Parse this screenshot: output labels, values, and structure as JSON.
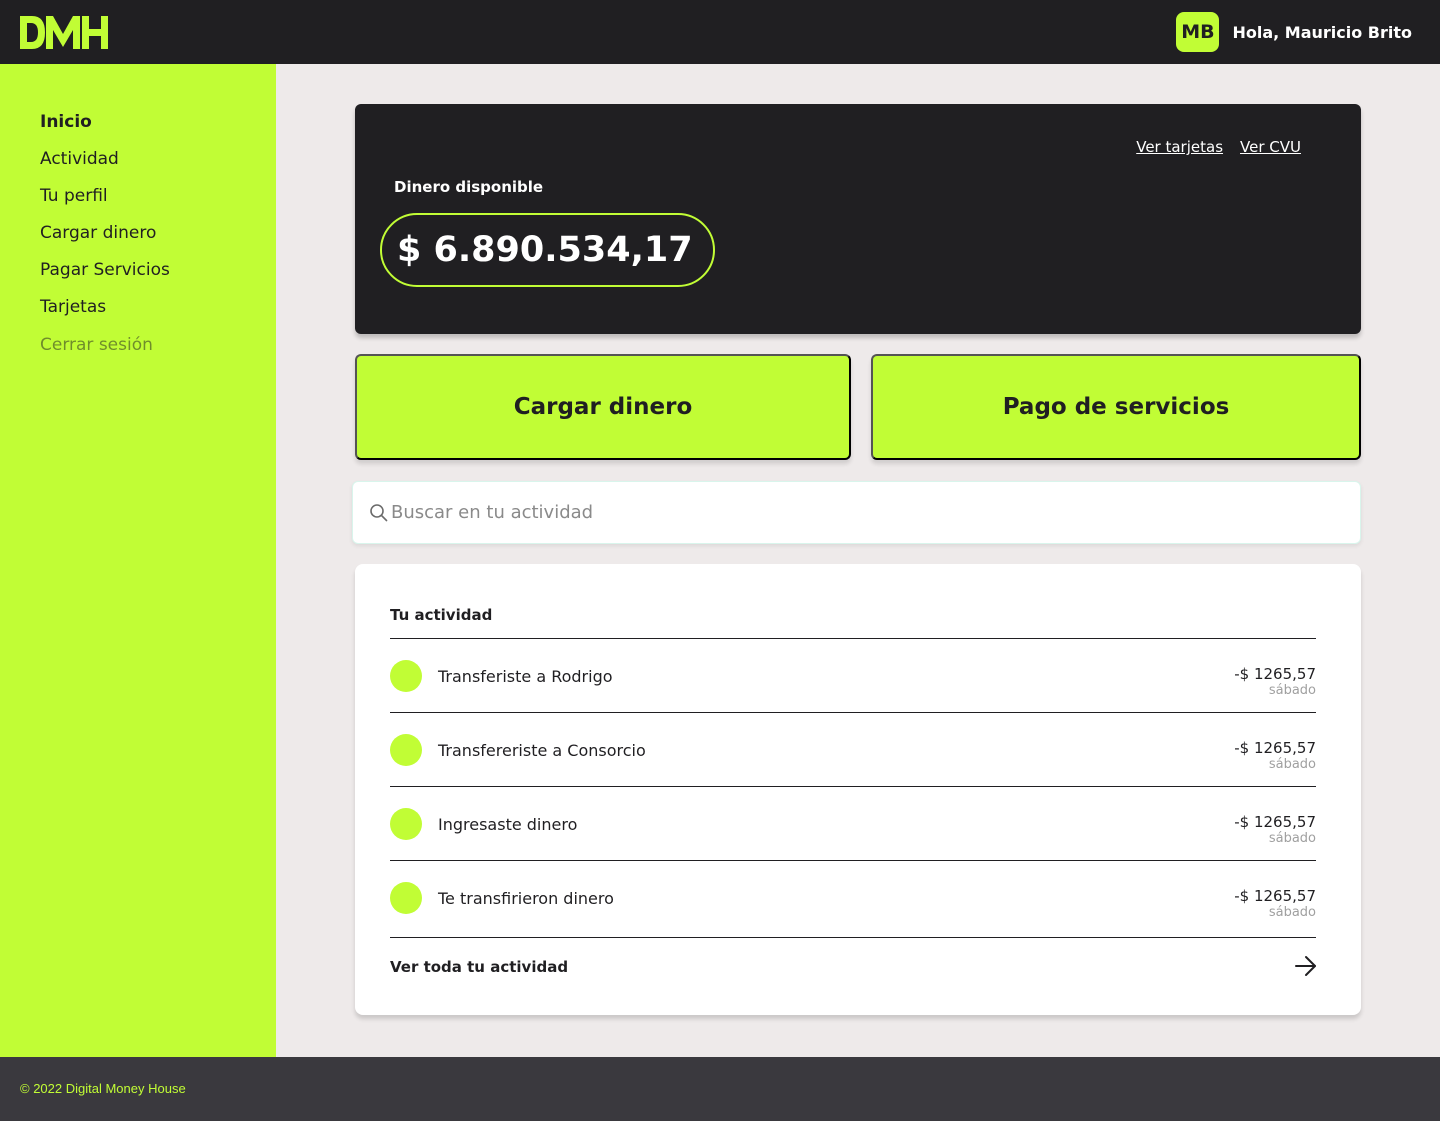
{
  "header": {
    "logo_text": "DMH",
    "avatar_initials": "MB",
    "greeting": "Hola, Mauricio Brito"
  },
  "sidebar": {
    "items": [
      {
        "label": "Inicio",
        "active": true
      },
      {
        "label": "Actividad",
        "active": false
      },
      {
        "label": "Tu perfil",
        "active": false
      },
      {
        "label": "Cargar dinero",
        "active": false
      },
      {
        "label": "Pagar Servicios",
        "active": false
      },
      {
        "label": "Tarjetas",
        "active": false
      },
      {
        "label": "Cerrar sesión",
        "active": false
      }
    ]
  },
  "balance": {
    "link_cards": "Ver tarjetas",
    "link_cvu": "Ver CVU",
    "label": "Dinero disponible",
    "amount": "$ 6.890.534,17"
  },
  "actions": {
    "load_money": "Cargar dinero",
    "pay_services": "Pago de servicios"
  },
  "search": {
    "placeholder": "Buscar en tu actividad",
    "value": ""
  },
  "activity": {
    "title": "Tu actividad",
    "rows": [
      {
        "description": "Transferiste a Rodrigo",
        "amount": "-$ 1265,57",
        "date": "sábado"
      },
      {
        "description": "Transfereriste a Consorcio",
        "amount": "-$ 1265,57",
        "date": "sábado"
      },
      {
        "description": "Ingresaste dinero",
        "amount": "-$ 1265,57",
        "date": "sábado"
      },
      {
        "description": "Te transfirieron dinero",
        "amount": "-$ 1265,57",
        "date": "sábado"
      }
    ],
    "see_all": "Ver toda tu actividad"
  },
  "footer": {
    "copyright": "© 2022 Digital Money House"
  },
  "colors": {
    "accent": "#C1FD35",
    "dark": "#201F22",
    "background": "#EEEAEA",
    "footer": "#3A393E"
  },
  "icons": {
    "search": "search-icon",
    "arrow": "arrow-right-icon"
  }
}
